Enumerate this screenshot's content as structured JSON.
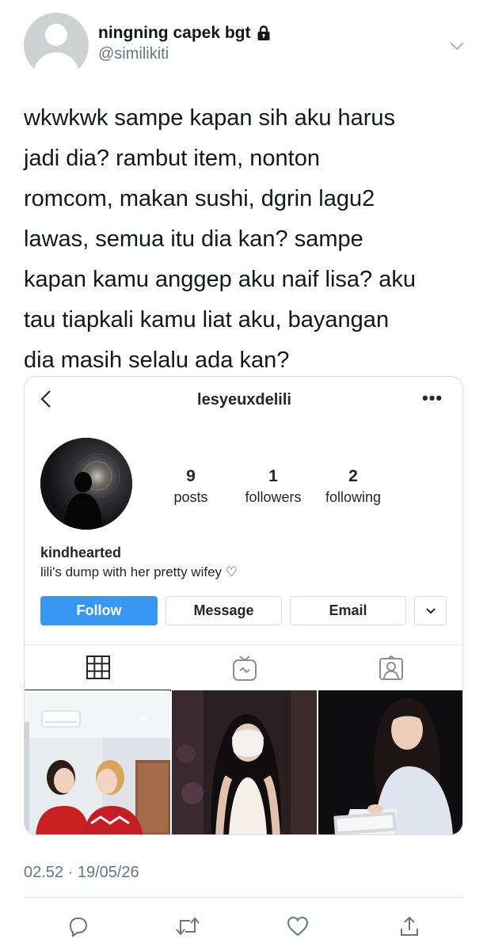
{
  "tweet": {
    "display_name": "ningning capek bgt",
    "handle": "@similikiti",
    "text_lines": [
      "wkwkwk sampe kapan sih aku harus",
      "jadi dia? rambut item, nonton",
      "romcom, makan sushi, dgrin lagu2",
      "lawas, semua itu dia kan? sampe",
      "kapan kamu anggep aku naif lisa? aku",
      "tau tiapkali kamu liat aku, bayangan",
      "dia masih selalu ada kan?"
    ],
    "timestamp": "02.52 · 19/05/26",
    "icons": {
      "lock": "lock-icon",
      "menu": "chevron-down-icon",
      "reply": "reply-icon",
      "retweet": "retweet-icon",
      "like": "heart-icon",
      "share": "share-icon"
    }
  },
  "instagram": {
    "username": "lesyeuxdelili",
    "more": "•••",
    "stats": {
      "posts_count": "9",
      "posts_label": "posts",
      "followers_count": "1",
      "followers_label": "followers",
      "following_count": "2",
      "following_label": "following"
    },
    "name": "kindhearted",
    "bio": "lili's dump with her pretty wifey ♡",
    "buttons": {
      "follow": "Follow",
      "message": "Message",
      "email": "Email"
    },
    "colors": {
      "follow_button": "#3897f0",
      "text": "#262626",
      "border": "#dbdbdb"
    },
    "tabs": [
      "grid-icon",
      "igtv-icon",
      "tagged-icon"
    ],
    "active_tab": 0
  },
  "colors": {
    "primary_text": "#14171a",
    "secondary_text": "#657786",
    "divider": "#e1e8ed"
  }
}
